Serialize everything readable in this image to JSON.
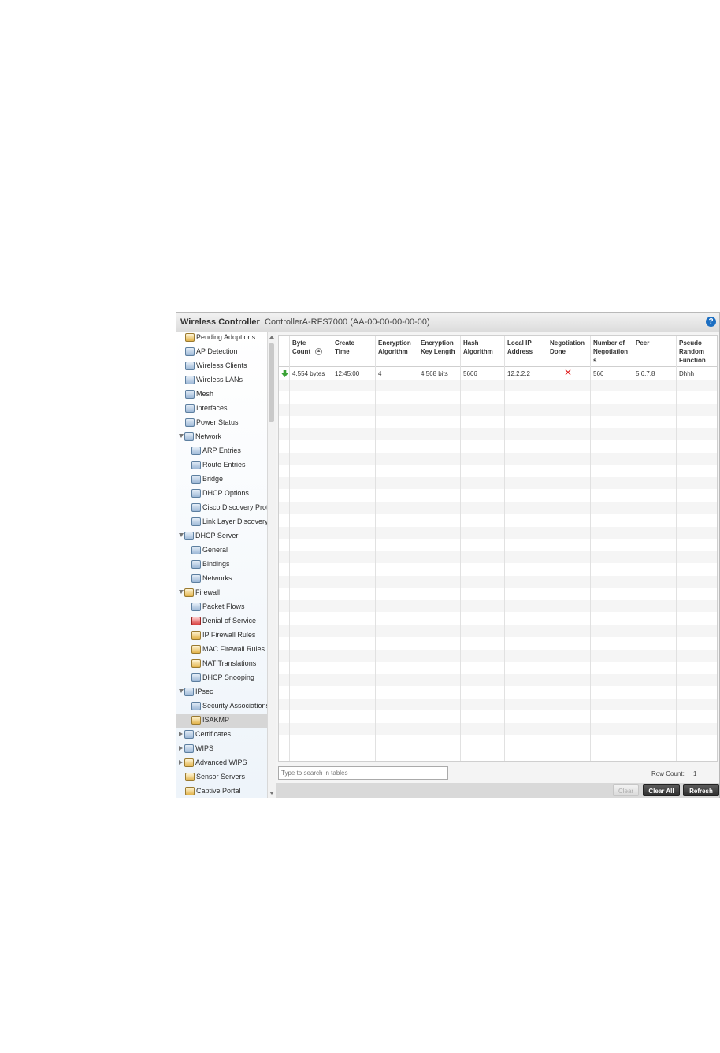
{
  "window": {
    "app_title": "Wireless Controller",
    "device_title": "ControllerA-RFS7000 (AA-00-00-00-00-00)",
    "help_icon": "help-icon"
  },
  "sidebar": {
    "items": [
      {
        "label": "Pending Adoptions",
        "icon": "adoption-icon"
      },
      {
        "label": "AP Detection",
        "icon": "ap-detection-icon"
      },
      {
        "label": "Wireless Clients",
        "icon": "clients-icon"
      },
      {
        "label": "Wireless LANs",
        "icon": "wlan-icon"
      },
      {
        "label": "Mesh",
        "icon": "mesh-icon"
      },
      {
        "label": "Interfaces",
        "icon": "interfaces-icon"
      },
      {
        "label": "Power Status",
        "icon": "power-icon"
      },
      {
        "label": "Network",
        "icon": "network-icon",
        "expanded": true
      },
      {
        "label": "ARP Entries",
        "icon": "table-icon"
      },
      {
        "label": "Route Entries",
        "icon": "table-icon"
      },
      {
        "label": "Bridge",
        "icon": "bridge-icon"
      },
      {
        "label": "DHCP Options",
        "icon": "dhcp-icon"
      },
      {
        "label": "Cisco Discovery Prot",
        "icon": "dhcp-icon"
      },
      {
        "label": "Link Layer Discovery",
        "icon": "dhcp-icon"
      },
      {
        "label": "DHCP Server",
        "icon": "dhcp-icon",
        "expanded": true
      },
      {
        "label": "General",
        "icon": "dhcp-icon"
      },
      {
        "label": "Bindings",
        "icon": "dhcp-icon"
      },
      {
        "label": "Networks",
        "icon": "dhcp-icon"
      },
      {
        "label": "Firewall",
        "icon": "firewall-icon",
        "expanded": true
      },
      {
        "label": "Packet Flows",
        "icon": "packet-flow-icon"
      },
      {
        "label": "Denial of Service",
        "icon": "dos-icon"
      },
      {
        "label": "IP Firewall Rules",
        "icon": "ip-rules-icon"
      },
      {
        "label": "MAC Firewall Rules",
        "icon": "mac-rules-icon"
      },
      {
        "label": "NAT Translations",
        "icon": "nat-icon"
      },
      {
        "label": "DHCP Snooping",
        "icon": "snooping-icon"
      },
      {
        "label": "IPsec",
        "icon": "ipsec-icon",
        "expanded": true
      },
      {
        "label": "Security Associations",
        "icon": "security-assoc-icon"
      },
      {
        "label": "ISAKMP",
        "icon": "isakmp-icon",
        "selected": true
      },
      {
        "label": "Certificates",
        "icon": "certificate-icon",
        "collapsed": true
      },
      {
        "label": "WIPS",
        "icon": "wips-icon",
        "collapsed": true
      },
      {
        "label": "Advanced WIPS",
        "icon": "advanced-wips-icon",
        "collapsed": true
      },
      {
        "label": "Sensor Servers",
        "icon": "sensor-icon"
      },
      {
        "label": "Captive Portal",
        "icon": "portal-icon"
      }
    ]
  },
  "table": {
    "columns": [
      {
        "line1": "Byte",
        "line2": "Count",
        "line3": "",
        "sortable": true
      },
      {
        "line1": "Create",
        "line2": "Time",
        "line3": ""
      },
      {
        "line1": "Encryption",
        "line2": "Algorithm",
        "line3": ""
      },
      {
        "line1": "Encryption",
        "line2": "Key Length",
        "line3": ""
      },
      {
        "line1": "Hash",
        "line2": "Algorithm",
        "line3": ""
      },
      {
        "line1": "Local IP",
        "line2": "Address",
        "line3": ""
      },
      {
        "line1": "Negotiation",
        "line2": "Done",
        "line3": ""
      },
      {
        "line1": "Number of",
        "line2": "Negotiation",
        "line3": "s"
      },
      {
        "line1": "Peer",
        "line2": "",
        "line3": ""
      },
      {
        "line1": "Pseudo",
        "line2": "Random",
        "line3": "Function"
      }
    ],
    "rows": [
      {
        "byte_count": "4,554 bytes",
        "create_time": "12:45:00",
        "encryption_algorithm": "4",
        "encryption_key_length": "4,568 bits",
        "hash_algorithm": "5666",
        "local_ip": "12.2.2.2",
        "negotiation_done": "false",
        "number_of_negotiations": "566",
        "peer": "5.6.7.8",
        "prf": "Dhhh"
      }
    ]
  },
  "footer": {
    "search_placeholder": "Type to search in tables",
    "row_count_label": "Row Count:",
    "row_count_value": "1",
    "clear_label": "Clear",
    "clear_all_label": "Clear All",
    "refresh_label": "Refresh"
  },
  "colors": {
    "accent": "#1b6ec2",
    "button_dark": "#3a3a3a",
    "error_x": "#e02020",
    "status_green": "#3aa236"
  }
}
